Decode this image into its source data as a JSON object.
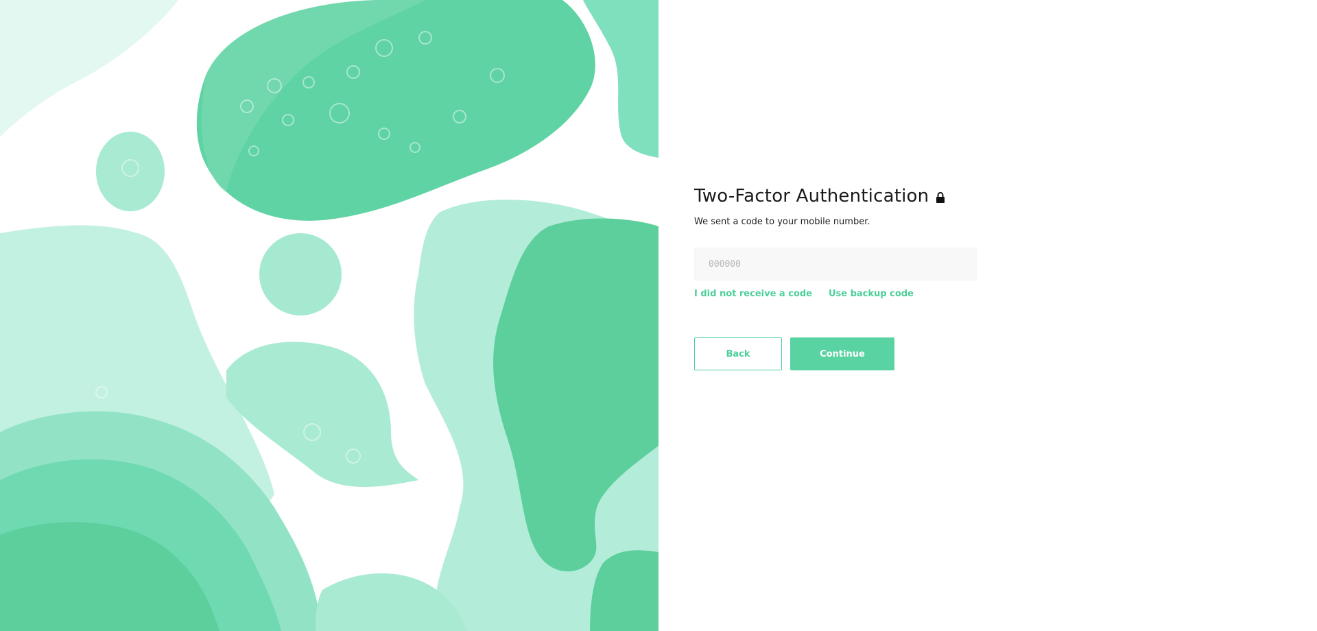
{
  "auth": {
    "title": "Two-Factor Authentication",
    "lock_icon": "lock-icon",
    "subtitle": "We sent a code to your mobile number.",
    "code_placeholder": "000000",
    "code_value": "",
    "links": {
      "no_code": "I did not receive a code",
      "backup": "Use backup code"
    },
    "buttons": {
      "back": "Back",
      "continue": "Continue"
    }
  },
  "colors": {
    "accent": "#4ccf99",
    "accent_fill": "#59d3a1",
    "input_bg": "#f8f8f8",
    "art_light": "#b3ecd9",
    "art_mid": "#7fe0bf",
    "art_dark": "#5ccf9c"
  }
}
